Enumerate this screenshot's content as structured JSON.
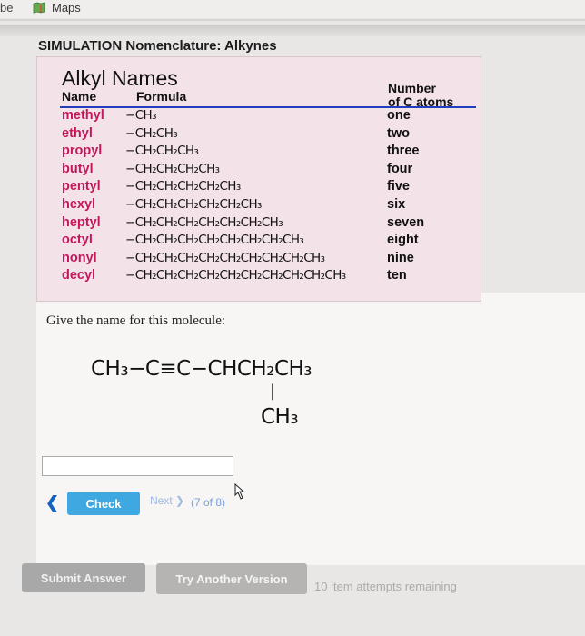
{
  "browser": {
    "prev_tab_fragment": "be",
    "bookmark": "Maps"
  },
  "page_title": "SIMULATION Nomenclature: Alkynes",
  "table": {
    "title": "Alkyl Names",
    "col_name": "Name",
    "col_formula": "Formula",
    "col_number": [
      "Number",
      "of C atoms"
    ],
    "rows": [
      {
        "name": "methyl",
        "formula": "−CH₃",
        "count": "one"
      },
      {
        "name": "ethyl",
        "formula": "−CH₂CH₃",
        "count": "two"
      },
      {
        "name": "propyl",
        "formula": "−CH₂CH₂CH₃",
        "count": "three"
      },
      {
        "name": "butyl",
        "formula": "−CH₂CH₂CH₂CH₃",
        "count": "four"
      },
      {
        "name": "pentyl",
        "formula": "−CH₂CH₂CH₂CH₂CH₃",
        "count": "five"
      },
      {
        "name": "hexyl",
        "formula": "−CH₂CH₂CH₂CH₂CH₂CH₃",
        "count": "six"
      },
      {
        "name": "heptyl",
        "formula": "−CH₂CH₂CH₂CH₂CH₂CH₂CH₃",
        "count": "seven"
      },
      {
        "name": "octyl",
        "formula": "−CH₂CH₂CH₂CH₂CH₂CH₂CH₂CH₃",
        "count": "eight"
      },
      {
        "name": "nonyl",
        "formula": "−CH₂CH₂CH₂CH₂CH₂CH₂CH₂CH₂CH₃",
        "count": "nine"
      },
      {
        "name": "decyl",
        "formula": "−CH₂CH₂CH₂CH₂CH₂CH₂CH₂CH₂CH₂CH₃",
        "count": "ten"
      }
    ]
  },
  "question": {
    "prompt": "Give the name for this molecule:",
    "main_chain": "CH₃−C≡C−CHCH₂CH₃",
    "branch_bond": "|",
    "branch": "CH₃"
  },
  "answer": {
    "value": "",
    "placeholder": ""
  },
  "nav": {
    "back": "❮",
    "check": "Check",
    "next": "Next ❯",
    "page": "(7 of 8)"
  },
  "footer": {
    "submit": "Submit Answer",
    "try_another": "Try Another Version",
    "attempts": "10 item attempts remaining"
  },
  "colors": {
    "alkyl_name": "#c2185b",
    "rule": "#1f3fbf",
    "check_button": "#40a8e0"
  }
}
